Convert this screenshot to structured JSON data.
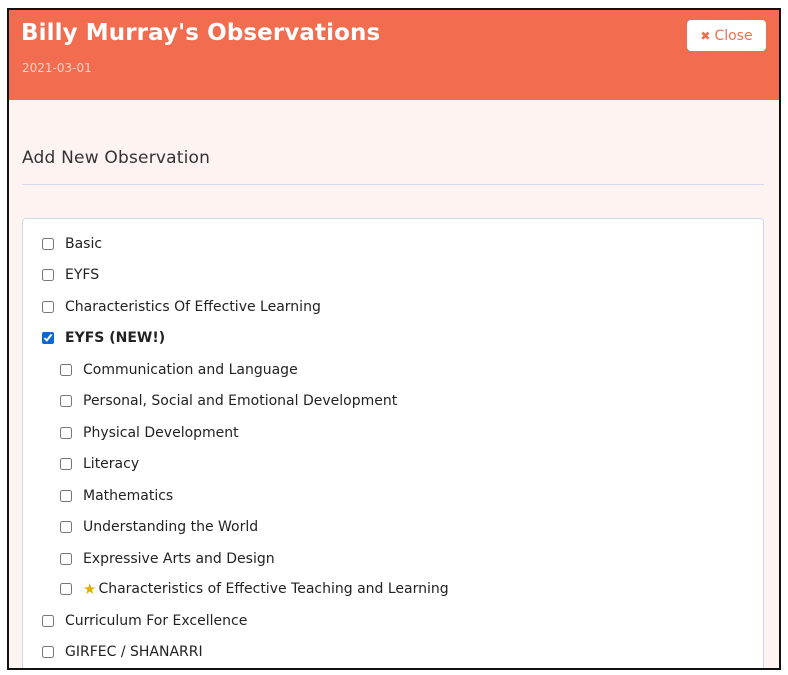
{
  "header": {
    "title": "Billy Murray's Observations",
    "date": "2021-03-01",
    "close_label": "Close",
    "close_icon": "times-icon",
    "color": "#f26c4f"
  },
  "form": {
    "section_title": "Add New Observation"
  },
  "options": [
    {
      "label": "Basic",
      "checked": false
    },
    {
      "label": "EYFS",
      "checked": false
    },
    {
      "label": "Characteristics Of Effective Learning",
      "checked": false
    },
    {
      "label": "EYFS (NEW!)",
      "checked": true
    },
    {
      "label": "Communication and Language",
      "checked": false
    },
    {
      "label": "Personal, Social and Emotional Development",
      "checked": false
    },
    {
      "label": "Physical Development",
      "checked": false
    },
    {
      "label": "Literacy",
      "checked": false
    },
    {
      "label": "Mathematics",
      "checked": false
    },
    {
      "label": "Understanding the World",
      "checked": false
    },
    {
      "label": "Expressive Arts and Design",
      "checked": false
    },
    {
      "label": "Characteristics of Effective Teaching and Learning",
      "checked": false,
      "icon": "star-icon"
    },
    {
      "label": "Curriculum For Excellence",
      "checked": false
    },
    {
      "label": "GIRFEC / SHANARRI",
      "checked": false
    }
  ]
}
